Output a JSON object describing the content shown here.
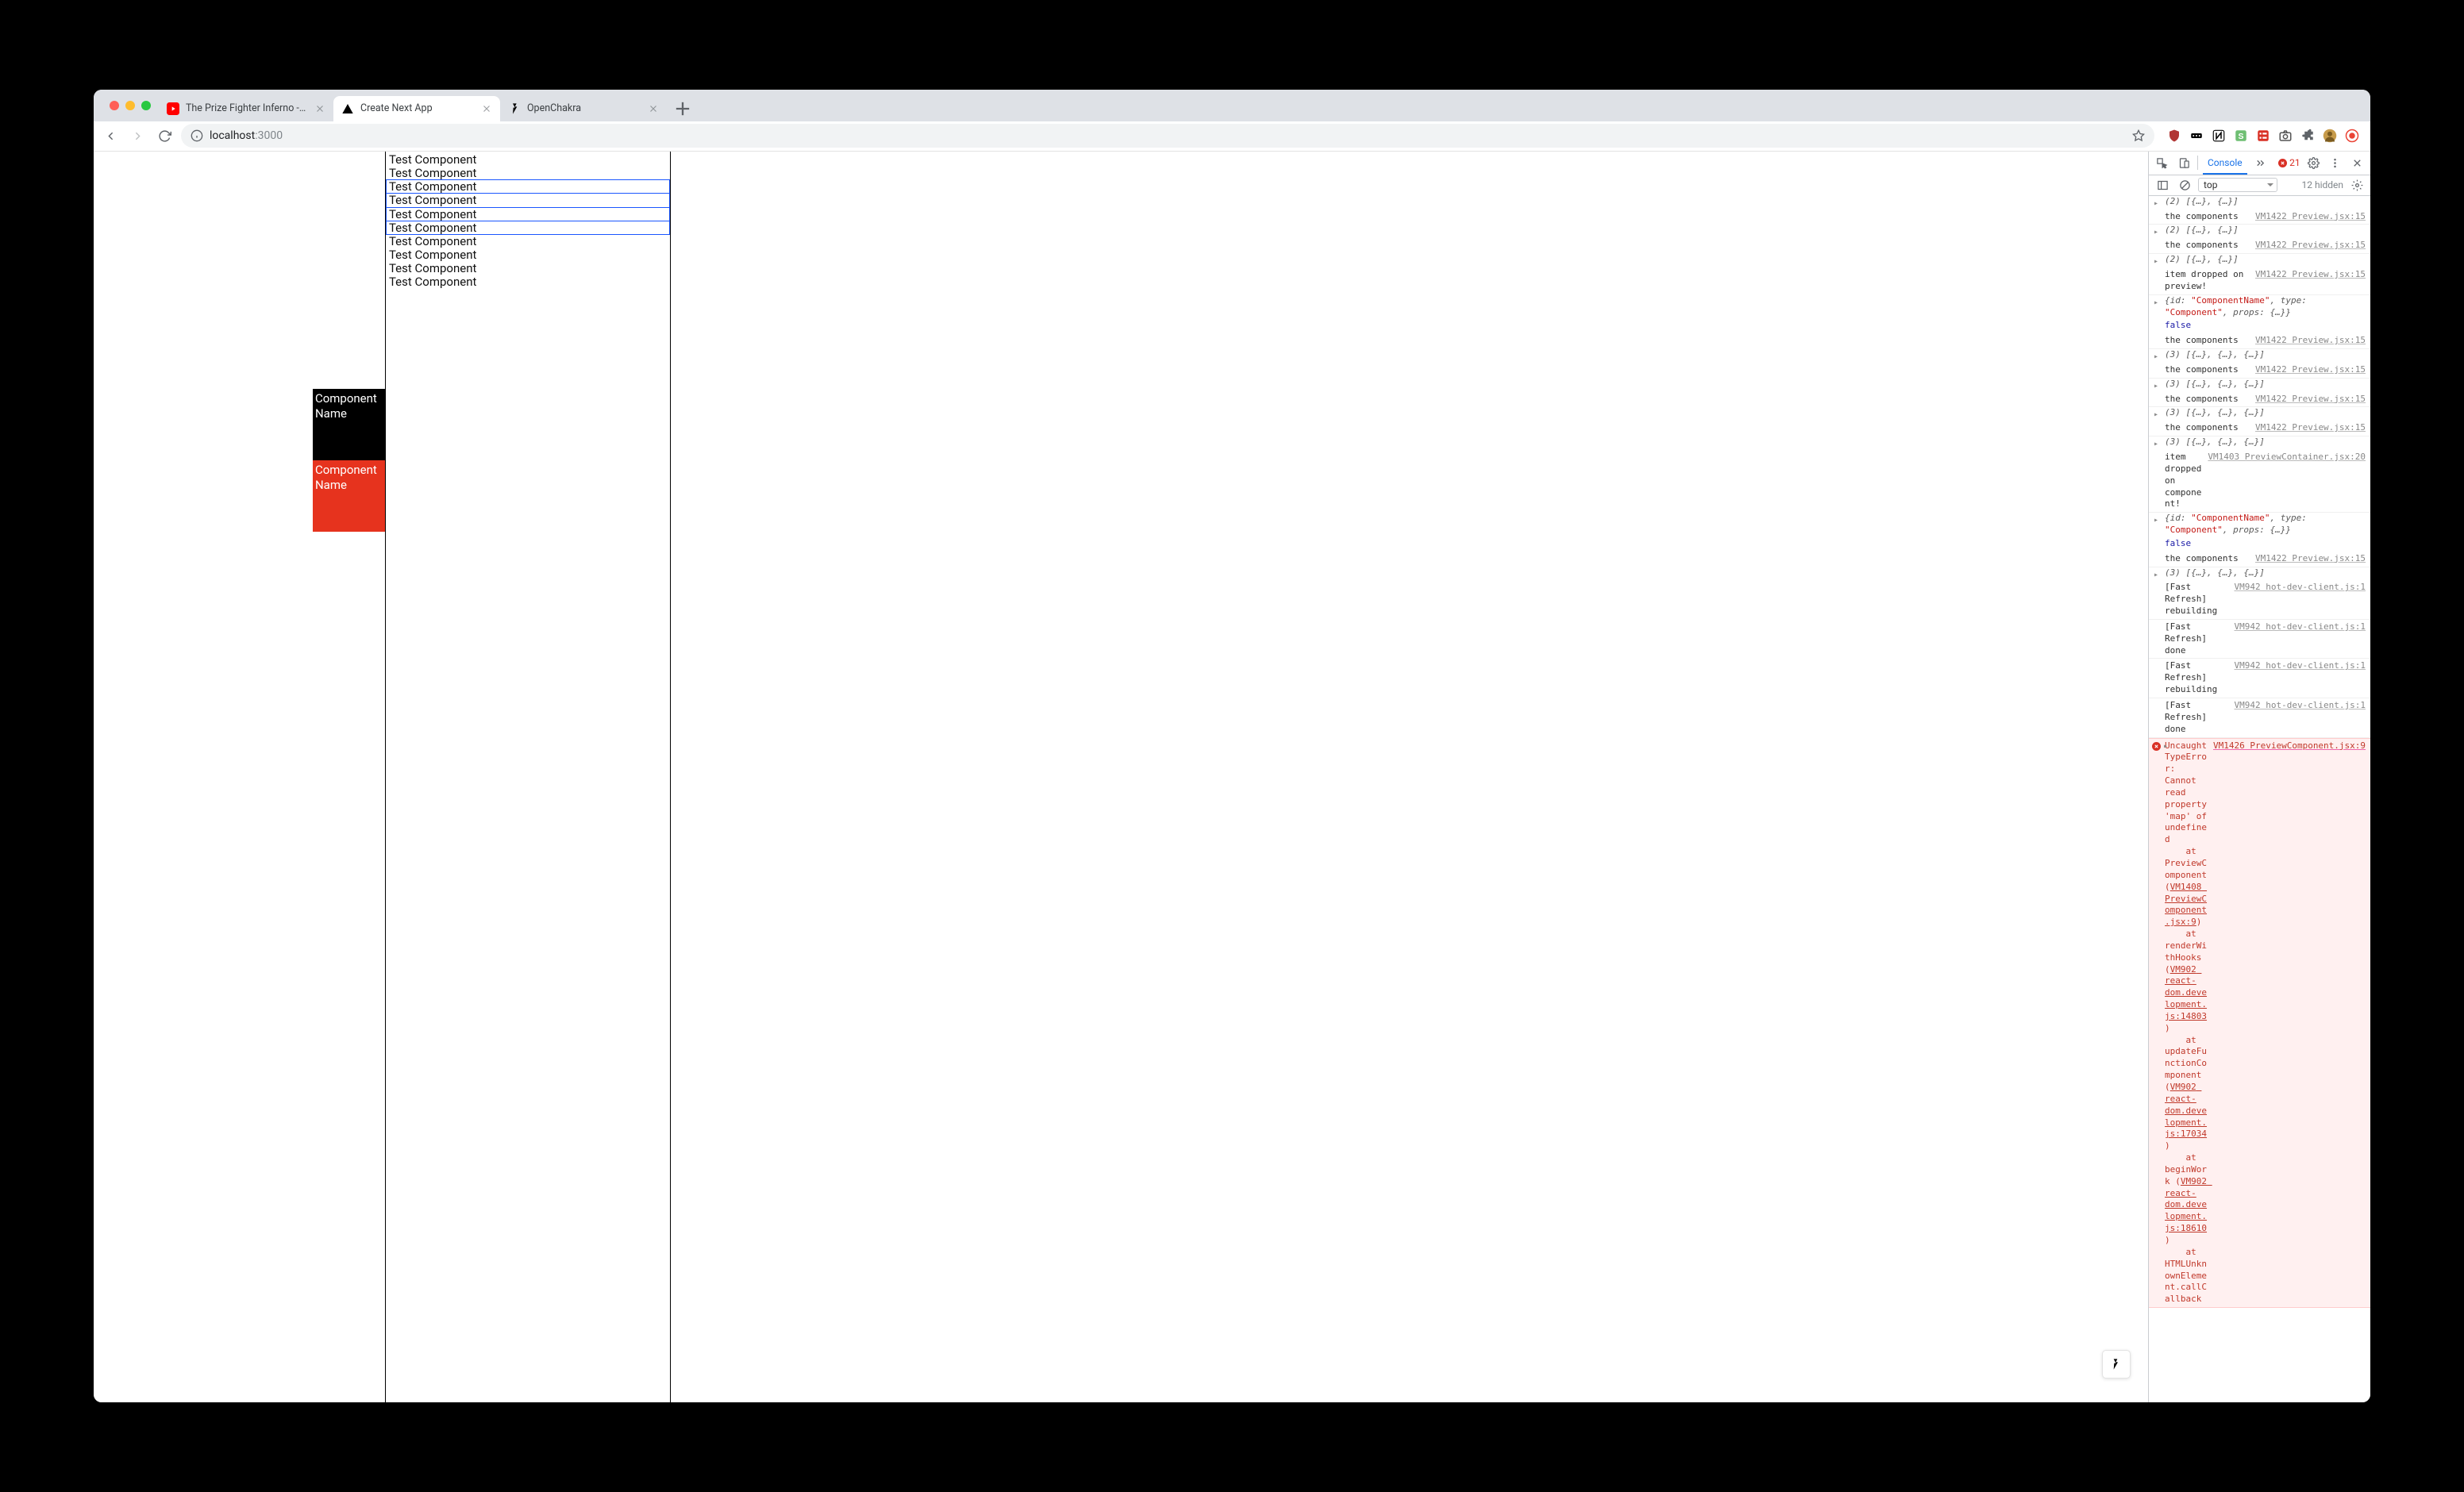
{
  "tabs": [
    {
      "title": "The Prize Fighter Inferno - Sta",
      "favicon": "youtube",
      "active": false
    },
    {
      "title": "Create Next App",
      "favicon": "vercel",
      "active": true
    },
    {
      "title": "OpenChakra",
      "favicon": "bolt",
      "active": false
    }
  ],
  "address": {
    "host": "localhost",
    "path": ":3000"
  },
  "extensions": [
    {
      "name": "ublock",
      "color": "#b13634"
    },
    {
      "name": "lastpass",
      "color": "#000000"
    },
    {
      "name": "notion",
      "color": "#ffffff"
    },
    {
      "name": "grammarly",
      "color": "#6fbf73"
    },
    {
      "name": "todo",
      "color": "#d93025"
    },
    {
      "name": "screenshot",
      "color": "#555"
    },
    {
      "name": "puzzle",
      "color": "#5f6368"
    },
    {
      "name": "avatar",
      "color": "#c79b4a"
    },
    {
      "name": "record",
      "color": "#ea4335"
    }
  ],
  "sidebar_cards": [
    {
      "label": "Component Name",
      "variant": "black"
    },
    {
      "label": "Component Name",
      "variant": "red"
    }
  ],
  "preview_items": [
    {
      "label": "Test Component",
      "selected": false
    },
    {
      "label": "Test Component",
      "selected": false
    },
    {
      "label": "Test Component",
      "selected": true
    },
    {
      "label": "Test Component",
      "selected": true
    },
    {
      "label": "Test Component",
      "selected": true
    },
    {
      "label": "Test Component",
      "selected": true
    },
    {
      "label": "Test Component",
      "selected": false
    },
    {
      "label": "Test Component",
      "selected": false
    },
    {
      "label": "Test Component",
      "selected": false
    },
    {
      "label": "Test Component",
      "selected": false
    }
  ],
  "devtools": {
    "active_tab": "Console",
    "error_count": "21",
    "context": "top",
    "hidden_label": "12 hidden",
    "logs": [
      {
        "type": "expand",
        "msg_html": "<span class='tok-obj'>(2) [{…}, {…}]</span>",
        "src": ""
      },
      {
        "type": "log",
        "msg_html": "the components",
        "src": "VM1422 Preview.jsx:15"
      },
      {
        "type": "expand",
        "msg_html": "<span class='tok-obj'>(2) [{…}, {…}]</span>",
        "src": ""
      },
      {
        "type": "log",
        "msg_html": "the components",
        "src": "VM1422 Preview.jsx:15"
      },
      {
        "type": "expand",
        "msg_html": "<span class='tok-obj'>(2) [{…}, {…}]</span>",
        "src": ""
      },
      {
        "type": "log",
        "msg_html": "item dropped on preview!",
        "src": "VM1422 Preview.jsx:15"
      },
      {
        "type": "expand",
        "msg_html": "<span class='tok-obj'>{id: </span><span class='tok-str'>\"ComponentName\"</span><span class='tok-obj'>, type: </span><span class='tok-str'>\"Component\"</span><span class='tok-obj'>, props: {…}}</span>",
        "src": ""
      },
      {
        "type": "plain",
        "msg_html": "<span class='tok-bool'>false</span>",
        "src": ""
      },
      {
        "type": "log",
        "msg_html": "the components",
        "src": "VM1422 Preview.jsx:15"
      },
      {
        "type": "expand",
        "msg_html": "<span class='tok-obj'>(3) [{…}, {…}, {…}]</span>",
        "src": ""
      },
      {
        "type": "log",
        "msg_html": "the components",
        "src": "VM1422 Preview.jsx:15"
      },
      {
        "type": "expand",
        "msg_html": "<span class='tok-obj'>(3) [{…}, {…}, {…}]</span>",
        "src": ""
      },
      {
        "type": "log",
        "msg_html": "the components",
        "src": "VM1422 Preview.jsx:15"
      },
      {
        "type": "expand",
        "msg_html": "<span class='tok-obj'>(3) [{…}, {…}, {…}]</span>",
        "src": ""
      },
      {
        "type": "log",
        "msg_html": "the components",
        "src": "VM1422 Preview.jsx:15"
      },
      {
        "type": "expand",
        "msg_html": "<span class='tok-obj'>(3) [{…}, {…}, {…}]</span>",
        "src": ""
      },
      {
        "type": "log",
        "msg_html": "item<br>dropped on component!",
        "src": "VM1403 PreviewContainer.jsx:20"
      },
      {
        "type": "expand",
        "msg_html": "<span class='tok-obj'>{id: </span><span class='tok-str'>\"ComponentName\"</span><span class='tok-obj'>, type: </span><span class='tok-str'>\"Component\"</span><span class='tok-obj'>, props: {…}}</span>",
        "src": ""
      },
      {
        "type": "plain",
        "msg_html": "<span class='tok-bool'>false</span>",
        "src": ""
      },
      {
        "type": "log",
        "msg_html": "the components",
        "src": "VM1422 Preview.jsx:15"
      },
      {
        "type": "expand",
        "msg_html": "<span class='tok-obj'>(3) [{…}, {…}, {…}]</span>",
        "src": ""
      },
      {
        "type": "log",
        "msg_html": "[Fast Refresh] rebuilding",
        "src": "VM942 hot-dev-client.js:1"
      },
      {
        "type": "log",
        "msg_html": "[Fast Refresh] done",
        "src": "VM942 hot-dev-client.js:1"
      },
      {
        "type": "log",
        "msg_html": "[Fast Refresh] rebuilding",
        "src": "VM942 hot-dev-client.js:1"
      },
      {
        "type": "log",
        "msg_html": "[Fast Refresh] done",
        "src": "VM942 hot-dev-client.js:1"
      },
      {
        "type": "error",
        "src": "VM1426 PreviewComponent.jsx:9",
        "msg_html": "Uncaught TypeError: Cannot read property 'map' of undefined<br>&nbsp;&nbsp;&nbsp;&nbsp;at PreviewComponent (<span class='u'>VM1408 PreviewComponent.jsx:9</span>)<br>&nbsp;&nbsp;&nbsp;&nbsp;at renderWithHooks (<span class='u'>VM902 react-dom.development.js:14803</span>)<br>&nbsp;&nbsp;&nbsp;&nbsp;at updateFunctionComponent (<span class='u'>VM902 react-dom.development.js:17034</span>)<br>&nbsp;&nbsp;&nbsp;&nbsp;at beginWork (<span class='u'>VM902 react-dom.development.js:18610</span>)<br>&nbsp;&nbsp;&nbsp;&nbsp;at HTMLUnknownElement.callCallback"
      }
    ]
  }
}
